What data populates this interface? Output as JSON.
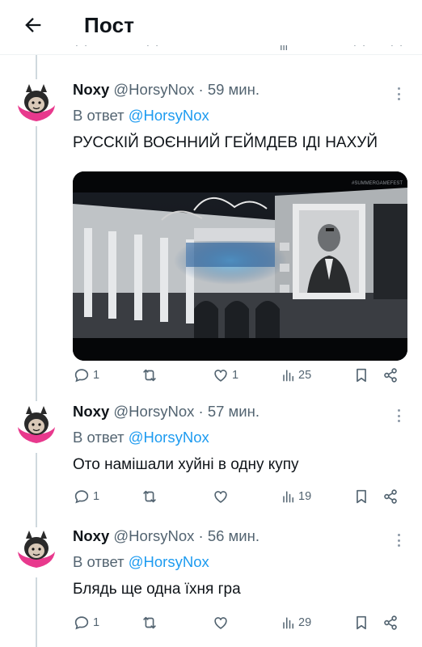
{
  "header": {
    "title": "Пост",
    "back_icon": "arrow-left-icon"
  },
  "colors": {
    "link": "#1d9bf0",
    "text": "#0f1419",
    "muted": "#536471",
    "divider": "#cfd9de"
  },
  "posts": [
    {
      "name": "Noxy",
      "handle": "@HorsyNox",
      "time": "· 59 мин.",
      "reply_prefix": "В ответ",
      "reply_mention": "@HorsyNox",
      "text": "РУССКІЙ ВОЄННИЙ ГЕЙМДЕВ ІДІ НАХУЙ",
      "media_watermark": "#SUMMERGAMEFEST",
      "stats": {
        "replies": "1",
        "reposts": "",
        "likes": "1",
        "views": "25"
      }
    },
    {
      "name": "Noxy",
      "handle": "@HorsyNox",
      "time": "· 57 мин.",
      "reply_prefix": "В ответ",
      "reply_mention": "@HorsyNox",
      "text": "Ото намішали хуйні в одну купу",
      "stats": {
        "replies": "1",
        "reposts": "",
        "likes": "",
        "views": "19"
      }
    },
    {
      "name": "Noxy",
      "handle": "@HorsyNox",
      "time": "· 56 мин.",
      "reply_prefix": "В ответ",
      "reply_mention": "@HorsyNox",
      "text": "Блядь ще одна їхня гра",
      "stats": {
        "replies": "1",
        "reposts": "",
        "likes": "",
        "views": "29"
      }
    }
  ]
}
